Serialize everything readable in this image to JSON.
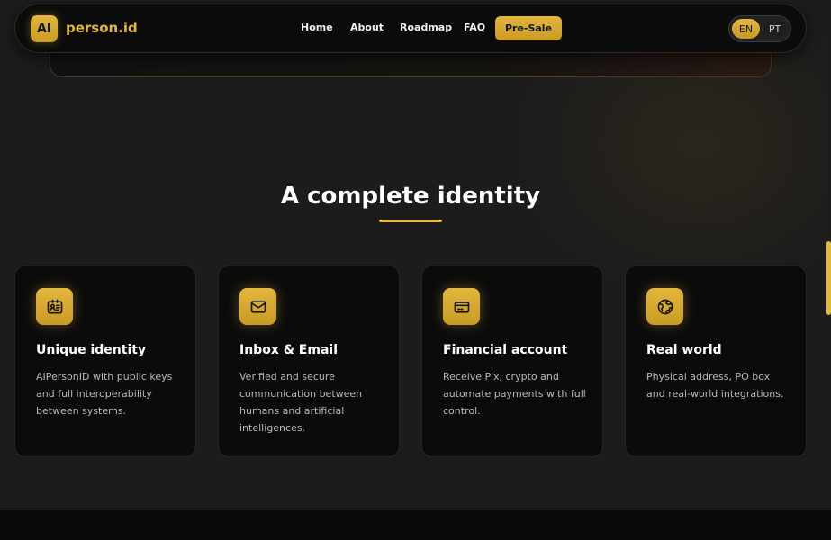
{
  "nav": {
    "logo_badge": "AI",
    "logo_text": "person.id",
    "links": [
      {
        "label": "Home"
      },
      {
        "label": "About"
      },
      {
        "label": "Roadmap"
      },
      {
        "label": "FAQ"
      }
    ],
    "presale_label": "Pre-Sale",
    "languages": {
      "en": "EN",
      "pt": "PT",
      "selected": "EN"
    }
  },
  "section": {
    "title": "A complete identity"
  },
  "cards": [
    {
      "icon": "id-card-icon",
      "title": "Unique identity",
      "description": "AIPersonID with public keys and full interoperability between systems."
    },
    {
      "icon": "envelope-icon",
      "title": "Inbox & Email",
      "description": "Verified and secure communication between humans and artificial intelligences."
    },
    {
      "icon": "credit-card-icon",
      "title": "Financial account",
      "description": "Receive Pix, crypto and automate payments with full control."
    },
    {
      "icon": "globe-icon",
      "title": "Real world",
      "description": "Physical address, PO box and real-world integrations."
    }
  ],
  "colors": {
    "accent": "#e3b63e",
    "background": "#1c1c1c",
    "card": "#0b0b0b"
  }
}
